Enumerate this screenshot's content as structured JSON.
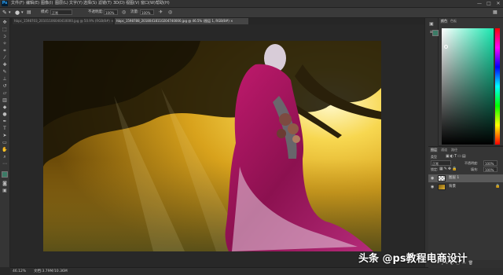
{
  "app": {
    "logo": "Ps"
  },
  "menu": {
    "items": [
      "文件(F)",
      "编辑(E)",
      "图像(I)",
      "图层(L)",
      "文字(Y)",
      "选择(S)",
      "滤镜(T)",
      "3D(D)",
      "视图(V)",
      "窗口(W)",
      "帮助(H)"
    ]
  },
  "window_controls": {
    "minimize": "—",
    "maximize": "□",
    "close": "✕"
  },
  "options": {
    "mode_label": "模式:",
    "mode_value": "正常",
    "opacity_label": "不透明度:",
    "opacity_value": "100%",
    "flow_label": "流量:",
    "flow_value": "100%"
  },
  "tabs": [
    {
      "label": "hbpc_1598703_20101106040410000.jpg @ 50.9% (RGB/8#) ×",
      "active": false
    },
    {
      "label": "hbpc_1598788_20180418110204740000.jpg @ 46.5% (图层 1, RGB/8#) ×",
      "active": true
    }
  ],
  "status": {
    "zoom": "46.12%",
    "doc_info": "文档:3.79M/10.36M"
  },
  "panels": {
    "color_tabs": [
      "颜色",
      "色板"
    ],
    "layers_tabs": [
      "图层",
      "通道",
      "路径"
    ],
    "kind_label": "类型",
    "blend_mode": "正常",
    "opacity_label": "不透明度:",
    "opacity_value": "100%",
    "lock_label": "锁定:",
    "fill_label": "填充:",
    "fill_value": "100%",
    "layers": [
      {
        "name": "图层 1",
        "active": true
      },
      {
        "name": "背景",
        "active": false
      }
    ]
  },
  "colors": {
    "hue_base": "#1ae8b0",
    "foreground": "#3c7b66",
    "background": "#ffffff"
  },
  "watermark": "头条 @ps教程电商设计"
}
